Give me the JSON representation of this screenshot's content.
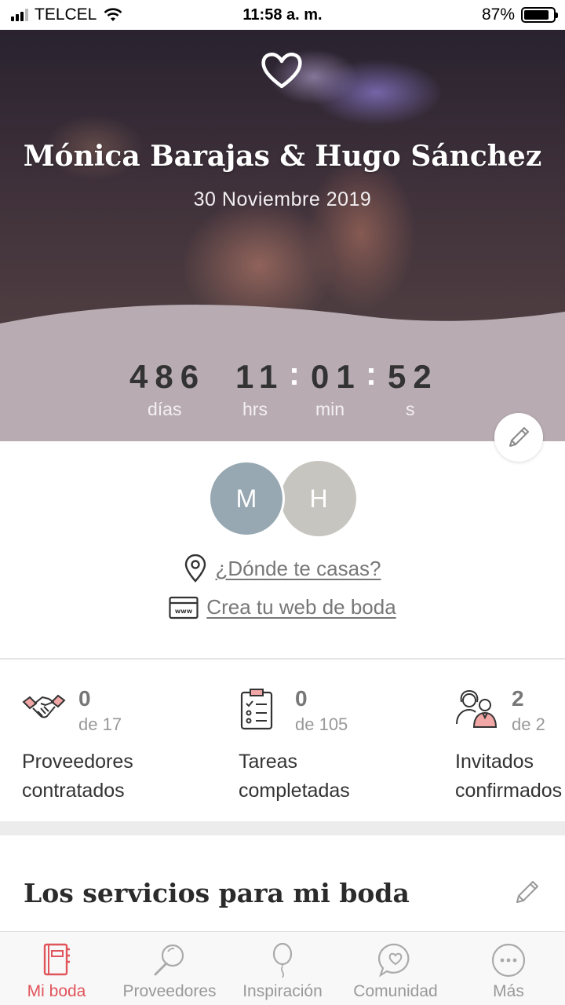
{
  "status_bar": {
    "carrier": "TELCEL",
    "time": "11:58 a. m.",
    "battery": "87%",
    "battery_level": 0.87
  },
  "hero": {
    "couple": "Mónica Barajas & Hugo Sánchez",
    "date": "30 Noviembre 2019",
    "countdown": {
      "days": "486",
      "hours": "11",
      "minutes": "01",
      "seconds": "52"
    },
    "labels": {
      "days": "días",
      "hours": "hrs",
      "minutes": "min",
      "seconds": "s"
    },
    "wave_color": "#b8acb2"
  },
  "avatars": [
    {
      "initial": "M",
      "color": "#97a8b2"
    },
    {
      "initial": "H",
      "color": "#c6c5c0"
    }
  ],
  "links": {
    "where": "¿Dónde te casas?",
    "web": "Crea tu web de boda"
  },
  "stats": [
    {
      "icon": "handshake-icon",
      "count": "0",
      "of": "de 17",
      "label_line1": "Proveedores",
      "label_line2": "contratados"
    },
    {
      "icon": "checklist-icon",
      "count": "0",
      "of": "de 105",
      "label_line1": "Tareas",
      "label_line2": "completadas"
    },
    {
      "icon": "guests-icon",
      "count": "2",
      "of": "de 2",
      "label_line1": "Invitados",
      "label_line2": "confirmados"
    }
  ],
  "section": {
    "title": "Los servicios para mi boda"
  },
  "tabs": [
    {
      "label": "Mi boda",
      "icon": "notebook-icon",
      "active": true
    },
    {
      "label": "Proveedores",
      "icon": "search-icon",
      "active": false
    },
    {
      "label": "Inspiración",
      "icon": "balloon-icon",
      "active": false
    },
    {
      "label": "Comunidad",
      "icon": "chat-heart-icon",
      "active": false
    },
    {
      "label": "Más",
      "icon": "more-icon",
      "active": false
    }
  ],
  "colors": {
    "accent": "#e0545b",
    "text": "#333333",
    "muted": "#999999"
  }
}
